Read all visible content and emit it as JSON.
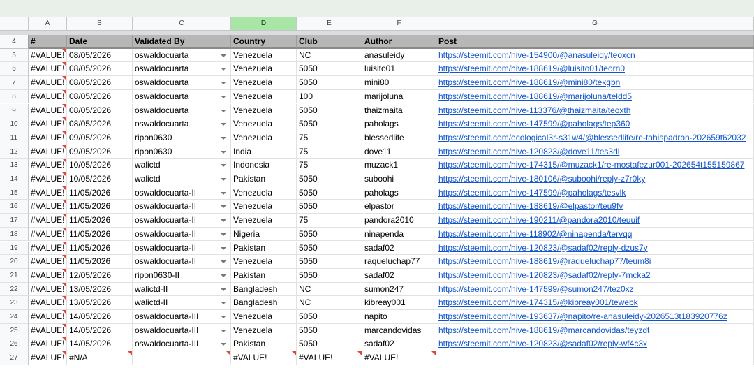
{
  "columns": [
    {
      "letter": "A",
      "header": "#"
    },
    {
      "letter": "B",
      "header": "Date"
    },
    {
      "letter": "C",
      "header": "Validated By"
    },
    {
      "letter": "D",
      "header": "Country"
    },
    {
      "letter": "E",
      "header": "Club"
    },
    {
      "letter": "F",
      "header": "Author"
    },
    {
      "letter": "G",
      "header": "Post"
    }
  ],
  "selected_column": "D",
  "header_row_number": "4",
  "rows": [
    {
      "n": "5",
      "a": "#VALUE!",
      "b": "08/05/2026",
      "c": "oswaldocuarta",
      "d": "Venezuela",
      "e": "NC",
      "f": "anasuleidy",
      "g": "https://steemit.com/hive-154900/@anasuleidy/teoxcn"
    },
    {
      "n": "6",
      "a": "#VALUE!",
      "b": "08/05/2026",
      "c": "oswaldocuarta",
      "d": "Venezuela",
      "e": "5050",
      "f": "luisito01",
      "g": "https://steemit.com/hive-188619/@luisito01/teorn0"
    },
    {
      "n": "7",
      "a": "#VALUE!",
      "b": "08/05/2026",
      "c": "oswaldocuarta",
      "d": "Venezuela",
      "e": "5050",
      "f": "mini80",
      "g": "https://steemit.com/hive-188619/@mini80/tekgbn"
    },
    {
      "n": "8",
      "a": "#VALUE!",
      "b": "08/05/2026",
      "c": "oswaldocuarta",
      "d": "Venezuela",
      "e": "100",
      "f": "marijoluna",
      "g": "https://steemit.com/hive-188619/@marijoluna/teldd5"
    },
    {
      "n": "9",
      "a": "#VALUE!",
      "b": "08/05/2026",
      "c": "oswaldocuarta",
      "d": "Venezuela",
      "e": "5050",
      "f": "thaizmaita",
      "g": "https://steemit.com/hive-113376/@thaizmaita/teoxth"
    },
    {
      "n": "10",
      "a": "#VALUE!",
      "b": "08/05/2026",
      "c": "oswaldocuarta",
      "d": "Venezuela",
      "e": "5050",
      "f": "paholags",
      "g": "https://steemit.com/hive-147599/@paholags/tep360"
    },
    {
      "n": "11",
      "a": "#VALUE!",
      "b": "09/05/2026",
      "c": "ripon0630",
      "d": "Venezuela",
      "e": "75",
      "f": "blessedlife",
      "g": "https://steemit.com/ecological3r-s31w4/@blessedlife/re-tahispadron-202659t62032"
    },
    {
      "n": "12",
      "a": "#VALUE!",
      "b": "09/05/2026",
      "c": "ripon0630",
      "d": "India",
      "e": "75",
      "f": "dove11",
      "g": "https://steemit.com/hive-120823/@dove11/tes3dl"
    },
    {
      "n": "13",
      "a": "#VALUE!",
      "b": "10/05/2026",
      "c": "walictd",
      "d": "Indonesia",
      "e": "75",
      "f": "muzack1",
      "g": "https://steemit.com/hive-174315/@muzack1/re-mostafezur001-202654t155159867"
    },
    {
      "n": "14",
      "a": "#VALUE!",
      "b": "10/05/2026",
      "c": "walictd",
      "d": "Pakistan",
      "e": "5050",
      "f": "suboohi",
      "g": "https://steemit.com/hive-180106/@suboohi/reply-z7r0ky"
    },
    {
      "n": "15",
      "a": "#VALUE!",
      "b": "11/05/2026",
      "c": "oswaldocuarta-II",
      "d": "Venezuela",
      "e": "5050",
      "f": "paholags",
      "g": "https://steemit.com/hive-147599/@paholags/tesvlk"
    },
    {
      "n": "16",
      "a": "#VALUE!",
      "b": "11/05/2026",
      "c": "oswaldocuarta-II",
      "d": "Venezuela",
      "e": "5050",
      "f": "elpastor",
      "g": "https://steemit.com/hive-188619/@elpastor/teu9fv"
    },
    {
      "n": "17",
      "a": "#VALUE!",
      "b": "11/05/2026",
      "c": "oswaldocuarta-II",
      "d": "Venezuela",
      "e": "75",
      "f": "pandora2010",
      "g": "https://steemit.com/hive-190211/@pandora2010/teuuif"
    },
    {
      "n": "18",
      "a": "#VALUE!",
      "b": "11/05/2026",
      "c": "oswaldocuarta-II",
      "d": "Nigeria",
      "e": "5050",
      "f": "ninapenda",
      "g": "https://steemit.com/hive-118902/@ninapenda/tervqq"
    },
    {
      "n": "19",
      "a": "#VALUE!",
      "b": "11/05/2026",
      "c": "oswaldocuarta-II",
      "d": "Pakistan",
      "e": "5050",
      "f": "sadaf02",
      "g": "https://steemit.com/hive-120823/@sadaf02/reply-dzus7y"
    },
    {
      "n": "20",
      "a": "#VALUE!",
      "b": "11/05/2026",
      "c": "oswaldocuarta-II",
      "d": "Venezuela",
      "e": "5050",
      "f": "raqueluchap77",
      "g": "https://steemit.com/hive-188619/@raqueluchap77/teum8i"
    },
    {
      "n": "21",
      "a": "#VALUE!",
      "b": "12/05/2026",
      "c": "ripon0630-II",
      "d": "Pakistan",
      "e": "5050",
      "f": "sadaf02",
      "g": "https://steemit.com/hive-120823/@sadaf02/reply-7mcka2"
    },
    {
      "n": "22",
      "a": "#VALUE!",
      "b": "13/05/2026",
      "c": "walictd-II",
      "d": "Bangladesh",
      "e": "NC",
      "f": "sumon247",
      "g": "https://steemit.com/hive-147599/@sumon247/tez0xz"
    },
    {
      "n": "23",
      "a": "#VALUE!",
      "b": "13/05/2026",
      "c": "walictd-II",
      "d": "Bangladesh",
      "e": "NC",
      "f": "kibreay001",
      "g": "https://steemit.com/hive-174315/@kibreay001/tewebk"
    },
    {
      "n": "24",
      "a": "#VALUE!",
      "b": "14/05/2026",
      "c": "oswaldocuarta-III",
      "d": "Venezuela",
      "e": "5050",
      "f": "napito",
      "g": "https://steemit.com/hive-193637/@napito/re-anasuleidy-2026513t183920776z"
    },
    {
      "n": "25",
      "a": "#VALUE!",
      "b": "14/05/2026",
      "c": "oswaldocuarta-III",
      "d": "Venezuela",
      "e": "5050",
      "f": "marcandovidas",
      "g": "https://steemit.com/hive-188619/@marcandovidas/teyzdt"
    },
    {
      "n": "26",
      "a": "#VALUE!",
      "b": "14/05/2026",
      "c": "oswaldocuarta-III",
      "d": "Pakistan",
      "e": "5050",
      "f": "sadaf02",
      "g": "https://steemit.com/hive-120823/@sadaf02/reply-wf4c3x"
    },
    {
      "n": "27",
      "a": "#VALUE!",
      "b": "#N/A",
      "c": "",
      "d": "#VALUE!",
      "e": "#VALUE!",
      "f": "#VALUE!",
      "g": ""
    }
  ]
}
